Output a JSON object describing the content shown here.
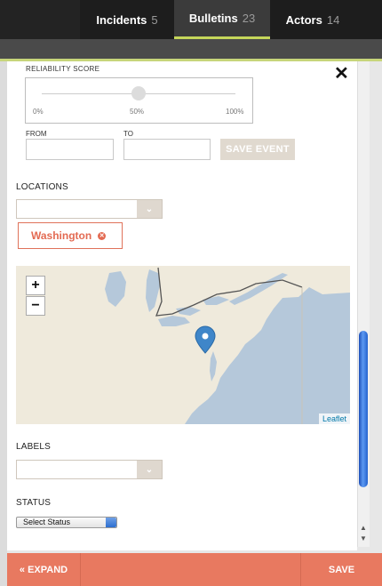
{
  "nav": {
    "tabs": [
      {
        "label": "Incidents",
        "count": "5"
      },
      {
        "label": "Bulletins",
        "count": "23"
      },
      {
        "label": "Actors",
        "count": "14"
      }
    ],
    "active_index": 1
  },
  "event_form": {
    "reliability": {
      "title": "RELIABILITY SCORE",
      "ticks": [
        "0%",
        "50%",
        "100%"
      ],
      "value_percent": 50
    },
    "from_label": "FROM",
    "to_label": "TO",
    "from_value": "",
    "to_value": "",
    "save_event_label": "SAVE EVENT"
  },
  "locations": {
    "label": "LOCATIONS",
    "select_value": "",
    "chips": [
      "Washington"
    ]
  },
  "map": {
    "zoom_in": "+",
    "zoom_out": "−",
    "attribution": "Leaflet"
  },
  "labels": {
    "label": "LABELS",
    "select_value": ""
  },
  "status": {
    "label": "STATUS",
    "selected": "Select Status"
  },
  "footer": {
    "expand_label": "« EXPAND",
    "save_label": "SAVE"
  },
  "colors": {
    "accent": "#e87960",
    "nav_active_underline": "#c5d65a",
    "marker": "#3f86c9"
  }
}
